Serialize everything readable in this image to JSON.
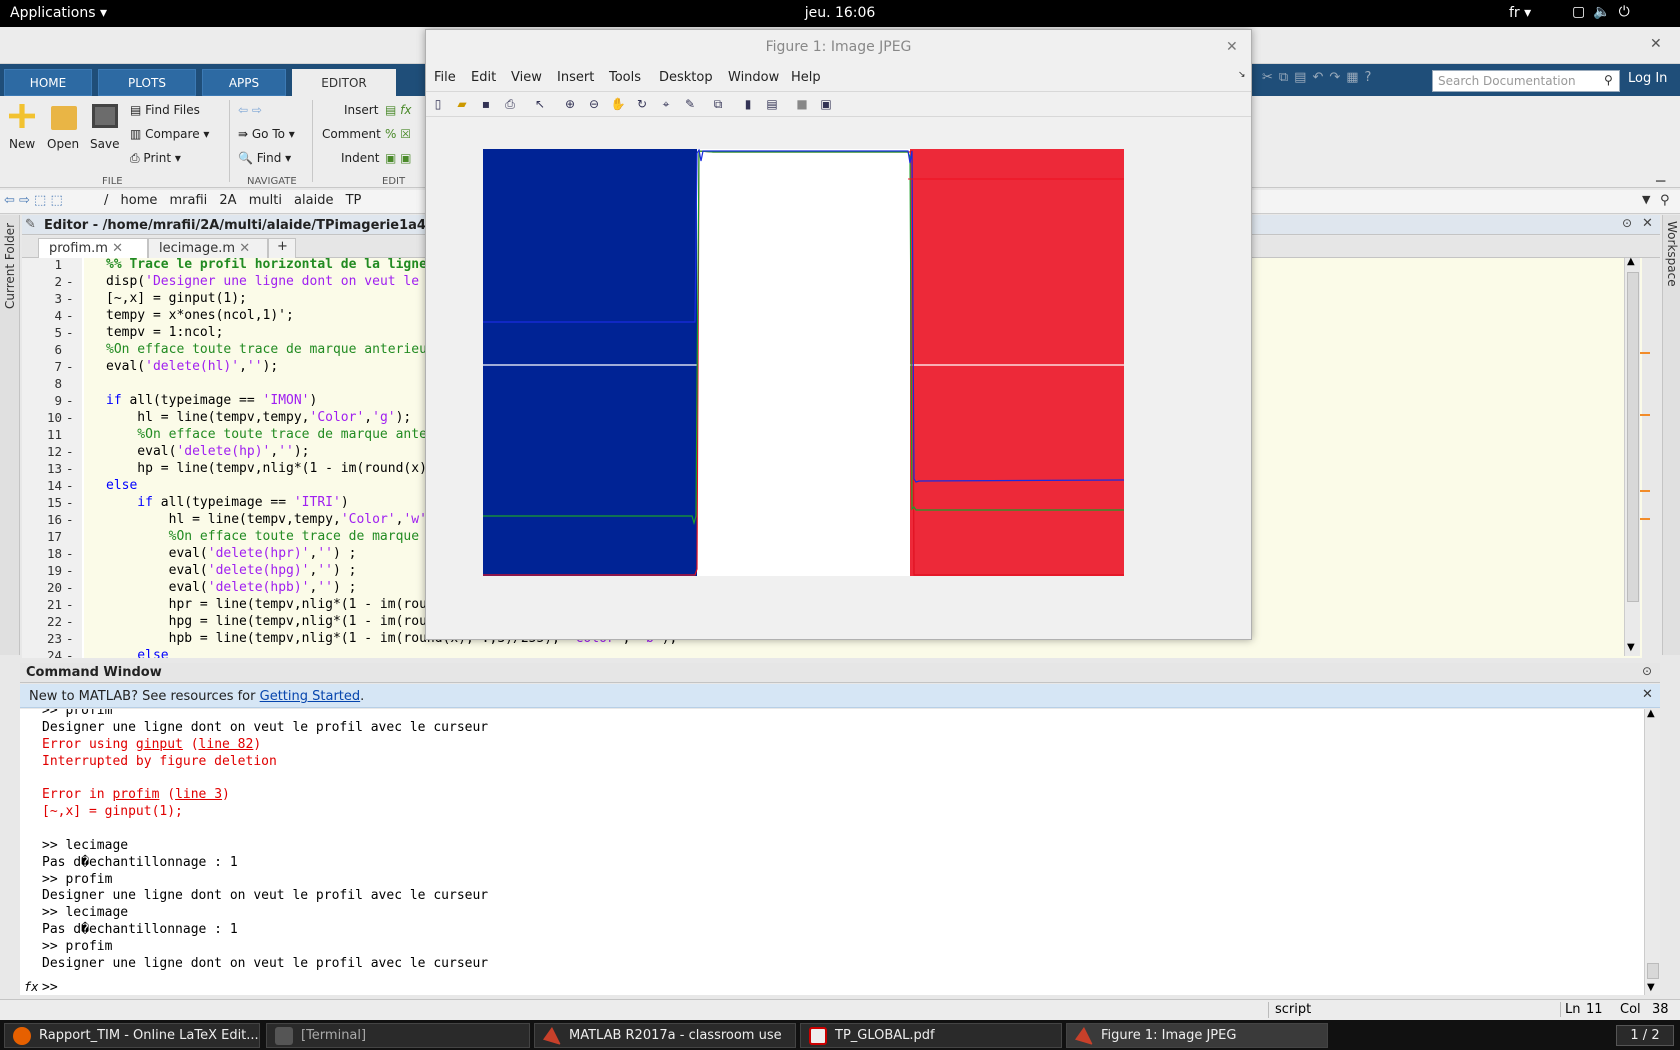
{
  "topbar": {
    "applications": "Applications ▾",
    "clock": "jeu. 16:06",
    "lang": "fr ▾"
  },
  "ribbon": {
    "tabs": [
      "HOME",
      "PLOTS",
      "APPS",
      "EDITOR"
    ],
    "new": "New",
    "open": "Open",
    "save": "Save",
    "find_files": "Find Files",
    "compare": "Compare ▾",
    "print": "Print ▾",
    "go_to": "Go To ▾",
    "find": "Find ▾",
    "insert": "Insert",
    "comment": "Comment",
    "indent": "Indent",
    "sections": {
      "file": "FILE",
      "navigate": "NAVIGATE",
      "edit": "EDIT"
    },
    "search_placeholder": "Search Documentation",
    "login": "Log In"
  },
  "address": {
    "path": "/  home  mrafii  2A  multi  alaide  TP"
  },
  "side": {
    "current_folder": "Current Folder",
    "workspace": "Workspace"
  },
  "editor": {
    "title": "Editor - /home/mrafii/2A/multi/alaide/TPimagerie1a4/pro",
    "tabs": [
      "profim.m",
      "lecimage.m"
    ],
    "tab_add": "+",
    "lines": [
      {
        "n": "1",
        "d": "",
        "segs": [
          [
            "cm bold",
            "%% Trace le profil horizontal de la ligne c"
          ]
        ]
      },
      {
        "n": "2",
        "d": "-",
        "segs": [
          [
            "",
            "disp("
          ],
          [
            "st",
            "'Designer une ligne dont on veut le pr"
          ]
        ]
      },
      {
        "n": "3",
        "d": "-",
        "segs": [
          [
            "",
            "[~,x] = ginput(1);"
          ]
        ]
      },
      {
        "n": "4",
        "d": "-",
        "segs": [
          [
            "",
            "tempy = x*ones(ncol,1)';"
          ]
        ]
      },
      {
        "n": "5",
        "d": "-",
        "segs": [
          [
            "",
            "tempv = 1:ncol;"
          ]
        ]
      },
      {
        "n": "6",
        "d": "",
        "segs": [
          [
            "cm",
            "%On efface toute trace de marque anterieure"
          ]
        ]
      },
      {
        "n": "7",
        "d": "-",
        "segs": [
          [
            "",
            "eval("
          ],
          [
            "st",
            "'delete(hl)'"
          ],
          [
            "",
            ","
          ],
          [
            "st",
            "''"
          ],
          [
            "",
            ");"
          ]
        ]
      },
      {
        "n": "8",
        "d": "",
        "segs": [
          [
            "",
            ""
          ]
        ]
      },
      {
        "n": "9",
        "d": "-",
        "segs": [
          [
            "kw",
            "if"
          ],
          [
            "",
            " all(typeimage == "
          ],
          [
            "st",
            "'IMON'"
          ],
          [
            "",
            ")"
          ]
        ]
      },
      {
        "n": "10",
        "d": "-",
        "segs": [
          [
            "",
            "    hl = line(tempv,tempy,"
          ],
          [
            "st",
            "'Color'"
          ],
          [
            "",
            ","
          ],
          [
            "st",
            "'g'"
          ],
          [
            "",
            ");"
          ]
        ]
      },
      {
        "n": "11",
        "d": "",
        "segs": [
          [
            "cm",
            "    %On efface toute trace de marque anteri"
          ]
        ]
      },
      {
        "n": "12",
        "d": "-",
        "segs": [
          [
            "",
            "    eval("
          ],
          [
            "st",
            "'delete(hp)'"
          ],
          [
            "",
            ","
          ],
          [
            "st",
            "''"
          ],
          [
            "",
            ");"
          ]
        ]
      },
      {
        "n": "13",
        "d": "-",
        "segs": [
          [
            "",
            "    hp = line(tempv,nlig*(1 - im(round(x),"
          ]
        ]
      },
      {
        "n": "14",
        "d": "-",
        "segs": [
          [
            "kw",
            "else"
          ]
        ]
      },
      {
        "n": "15",
        "d": "-",
        "segs": [
          [
            "kw",
            "    if"
          ],
          [
            "",
            " all(typeimage == "
          ],
          [
            "st",
            "'ITRI'"
          ],
          [
            "",
            ")"
          ]
        ]
      },
      {
        "n": "16",
        "d": "-",
        "segs": [
          [
            "",
            "        hl = line(tempv,tempy,"
          ],
          [
            "st",
            "'Color'"
          ],
          [
            "",
            ","
          ],
          [
            "st",
            "'w'"
          ],
          [
            "",
            ");"
          ]
        ]
      },
      {
        "n": "17",
        "d": "",
        "segs": [
          [
            "cm",
            "        %On efface toute trace de marque an"
          ]
        ]
      },
      {
        "n": "18",
        "d": "-",
        "segs": [
          [
            "",
            "        eval("
          ],
          [
            "st",
            "'delete(hpr)'"
          ],
          [
            "",
            ","
          ],
          [
            "st",
            "''"
          ],
          [
            "",
            ") ;"
          ]
        ]
      },
      {
        "n": "19",
        "d": "-",
        "segs": [
          [
            "",
            "        eval("
          ],
          [
            "st",
            "'delete(hpg)'"
          ],
          [
            "",
            ","
          ],
          [
            "st",
            "''"
          ],
          [
            "",
            ") ;"
          ]
        ]
      },
      {
        "n": "20",
        "d": "-",
        "segs": [
          [
            "",
            "        eval("
          ],
          [
            "st",
            "'delete(hpb)'"
          ],
          [
            "",
            ","
          ],
          [
            "st",
            "''"
          ],
          [
            "",
            ") ;"
          ]
        ]
      },
      {
        "n": "21",
        "d": "-",
        "segs": [
          [
            "",
            "        hpr = line(tempv,nlig*(1 - im(round"
          ]
        ]
      },
      {
        "n": "22",
        "d": "-",
        "segs": [
          [
            "",
            "        hpg = line(tempv,nlig*(1 - im(round"
          ]
        ]
      },
      {
        "n": "23",
        "d": "-",
        "segs": [
          [
            "",
            "        hpb = line(tempv,nlig*(1 - im(round(x), :,3)/255), "
          ],
          [
            "st",
            "'Color'"
          ],
          [
            "",
            ", "
          ],
          [
            "st",
            "'b'"
          ],
          [
            "",
            ");"
          ]
        ]
      },
      {
        "n": "24",
        "d": "-",
        "segs": [
          [
            "kw",
            "    else"
          ]
        ]
      }
    ]
  },
  "command": {
    "title": "Command Window",
    "notice_pre": "New to MATLAB? See resources for ",
    "notice_link": "Getting Started",
    "notice_post": ".",
    "lines": [
      {
        "c": "",
        "segs": [
          [
            "",
            ">> profim"
          ]
        ]
      },
      {
        "c": "",
        "segs": [
          [
            "",
            "Designer une ligne dont on veut le profil avec le curseur"
          ]
        ]
      },
      {
        "c": "err",
        "segs": [
          [
            "",
            "Error using "
          ],
          [
            "u bold",
            "ginput"
          ],
          [
            "",
            " ("
          ],
          [
            "u",
            "line 82"
          ],
          [
            "",
            ")"
          ]
        ]
      },
      {
        "c": "err",
        "segs": [
          [
            "",
            "Interrupted by figure deletion"
          ]
        ]
      },
      {
        "c": "",
        "segs": [
          [
            "",
            ""
          ]
        ]
      },
      {
        "c": "err",
        "segs": [
          [
            "",
            "Error in "
          ],
          [
            "u bold",
            "profim"
          ],
          [
            "",
            " ("
          ],
          [
            "u",
            "line 3"
          ],
          [
            "",
            ")"
          ]
        ]
      },
      {
        "c": "err",
        "segs": [
          [
            "",
            "[~,x] = ginput(1);"
          ]
        ]
      },
      {
        "c": "",
        "segs": [
          [
            "",
            ""
          ]
        ]
      },
      {
        "c": "",
        "segs": [
          [
            "",
            ">> lecimage"
          ]
        ]
      },
      {
        "c": "",
        "segs": [
          [
            "",
            "Pas d�echantillonnage : 1"
          ]
        ]
      },
      {
        "c": "",
        "segs": [
          [
            "",
            ">> profim"
          ]
        ]
      },
      {
        "c": "",
        "segs": [
          [
            "",
            "Designer une ligne dont on veut le profil avec le curseur"
          ]
        ]
      },
      {
        "c": "",
        "segs": [
          [
            "",
            ">> lecimage"
          ]
        ]
      },
      {
        "c": "",
        "segs": [
          [
            "",
            "Pas d�echantillonnage : 1"
          ]
        ]
      },
      {
        "c": "",
        "segs": [
          [
            "",
            ">> profim"
          ]
        ]
      },
      {
        "c": "",
        "segs": [
          [
            "",
            "Designer une ligne dont on veut le profil avec le curseur"
          ]
        ]
      }
    ],
    "prompt": ">>",
    "fx": "fx"
  },
  "status": {
    "mode": "script",
    "ln_label": "Ln",
    "ln": "11",
    "col_label": "Col",
    "col": "38"
  },
  "taskbar": {
    "items": [
      "Rapport_TIM - Online LaTeX Edit...",
      "[Terminal]",
      "MATLAB R2017a - classroom use",
      "TP_GLOBAL.pdf",
      "Figure 1: Image JPEG"
    ],
    "pager": "1 / 2"
  },
  "figure": {
    "title": "Figure 1: Image JPEG",
    "menu": [
      "File",
      "Edit",
      "View",
      "Insert",
      "Tools",
      "Desktop",
      "Window",
      "Help"
    ],
    "flag_colors": {
      "blue": "#002395",
      "white": "#ffffff",
      "red": "#ed2939"
    },
    "image_note": "French flag image with overlaid intensity profile lines (white horizontal, red, green, blue)"
  }
}
